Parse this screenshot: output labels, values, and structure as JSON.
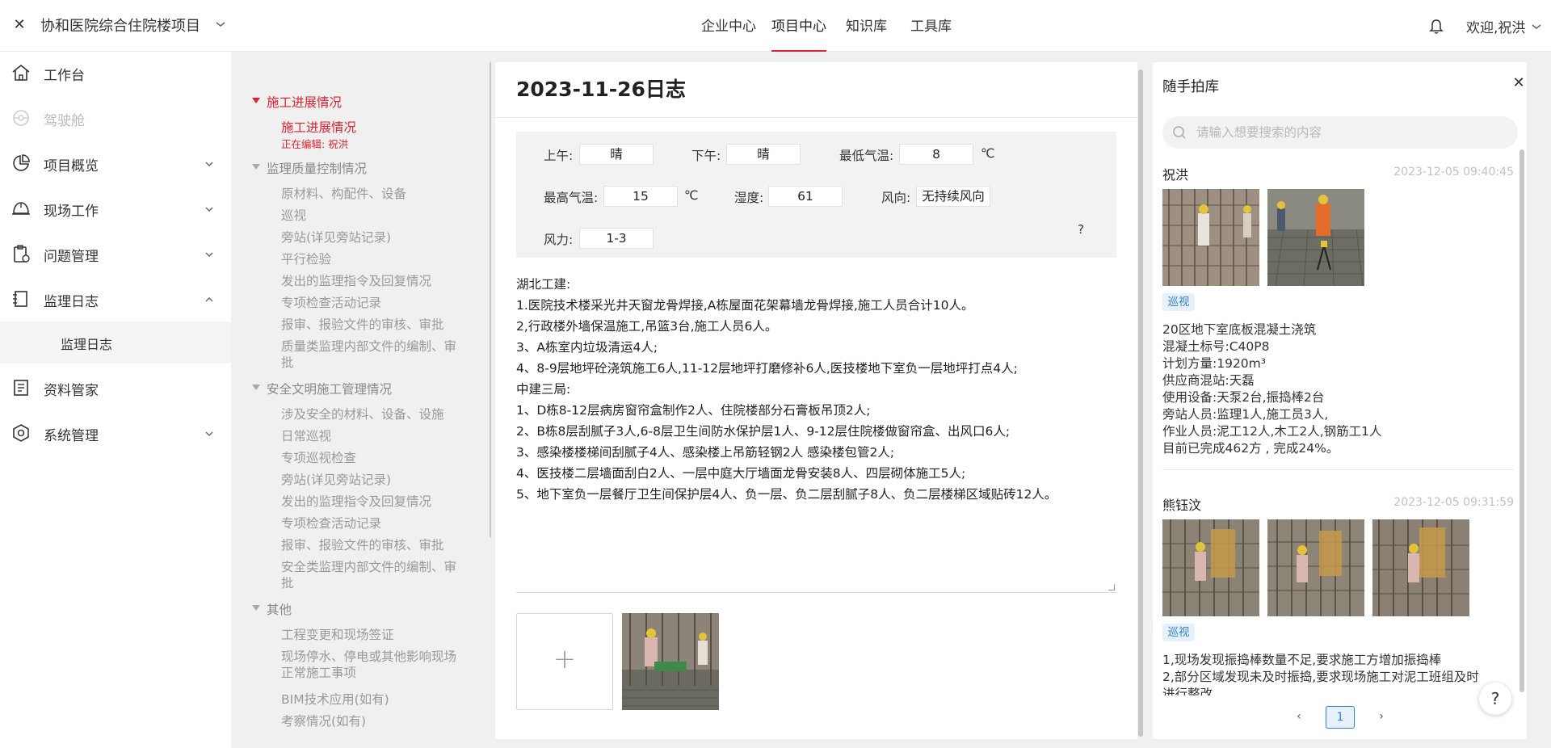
{
  "topbar": {
    "project_name": "协和医院综合住院楼项目",
    "nav": [
      "企业中心",
      "项目中心",
      "知识库",
      "工具库"
    ],
    "active_nav": "项目中心",
    "user_greeting": "欢迎,祝洪"
  },
  "sidebar": {
    "items": [
      {
        "label": "工作台",
        "icon": "home-icon"
      },
      {
        "label": "驾驶舱",
        "icon": "dashboard-icon"
      },
      {
        "label": "项目概览",
        "icon": "pie-chart-icon"
      },
      {
        "label": "现场工作",
        "icon": "helmet-icon"
      },
      {
        "label": "问题管理",
        "icon": "clipboard-icon"
      },
      {
        "label": "监理日志",
        "icon": "log-icon"
      },
      {
        "label": "资料管家",
        "icon": "document-icon"
      },
      {
        "label": "系统管理",
        "icon": "settings-icon"
      }
    ],
    "sub_item": "监理日志"
  },
  "tree": {
    "sec1": "施工进展情况",
    "sec1_item": "施工进展情况",
    "editing": "正在编辑: 祝洪",
    "sec2": "监理质量控制情况",
    "sec2_items": [
      "原材料、构配件、设备",
      "巡视",
      "旁站(详见旁站记录)",
      "平行检验",
      "发出的监理指令及回复情况",
      "专项检查活动记录",
      "报审、报验文件的审核、审批",
      "质量类监理内部文件的编制、审批"
    ],
    "sec3": "安全文明施工管理情况",
    "sec3_items": [
      "涉及安全的材料、设备、设施",
      "日常巡视",
      "专项巡视检查",
      "旁站(详见旁站记录)",
      "发出的监理指令及回复情况",
      "专项检查活动记录",
      "报审、报验文件的审核、审批",
      "安全类监理内部文件的编制、审批"
    ],
    "sec4": "其他",
    "sec4_items": [
      "工程变更和现场签证",
      "现场停水、停电或其他影响现场正常施工事项",
      "BIM技术应用(如有)",
      "考察情况(如有)"
    ]
  },
  "doc": {
    "title": "2023-11-26日志",
    "weather": {
      "am_label": "上午:",
      "am": "晴",
      "pm_label": "下午:",
      "pm": "晴",
      "tmin_label": "最低气温:",
      "tmin": "8",
      "tmax_label": "最高气温:",
      "tmax": "15",
      "unit": "℃",
      "humidity_label": "湿度:",
      "humidity": "61",
      "wind_dir_label": "风向:",
      "wind_dir": "无持续风向",
      "wind_label": "风力:",
      "wind": "1-3",
      "help": "?"
    },
    "lines": [
      "湖北工建:",
      "1.医院技术楼采光井天窗龙骨焊接,A栋屋面花架幕墙龙骨焊接,施工人员合计10人。",
      "2,行政楼外墙保温施工,吊篮3台,施工人员6人。",
      "3、A栋室内垃圾清运4人;",
      "4、8-9层地坪砼浇筑施工6人,11-12层地坪打磨修补6人,医技楼地下室负一层地坪打点4人;",
      "中建三局:",
      "1、D栋8-12层病房窗帘盒制作2人、住院楼部分石膏板吊顶2人;",
      "2、B栋8层刮腻子3人,6-8层卫生间防水保护层1人、9-12层住院楼做窗帘盒、出风口6人;",
      "3、感染楼楼梯间刮腻子4人、感染楼上吊筋轻钢2人 感染楼包管2人;",
      "4、医技楼二层墙面刮白2人、一层中庭大厅墙面龙骨安装8人、四层砌体施工5人;",
      "5、地下室负一层餐厅卫生间保护层4人、负一层、负二层刮腻子8人、负二层楼梯区域贴砖12人。"
    ],
    "upload_label": "+"
  },
  "photos": {
    "title": "随手拍库",
    "search_placeholder": "请输入想要搜索的内容",
    "cards": [
      {
        "author": "祝洪",
        "time": "2023-12-05 09:40:45",
        "tag": "巡视",
        "text": [
          " 20区地下室底板混凝土浇筑",
          "混凝土标号:C40P8",
          "计划方量:1920m³",
          "供应商混站:天磊",
          "使用设备:天泵2台,振捣棒2台",
          "旁站人员:监理1人,施工员3人,",
          "作业人员:泥工12人,木工2人,钢筋工1人",
          "目前已完成462方 , 完成24%。"
        ]
      },
      {
        "author": "熊钰汶",
        "time": "2023-12-05 09:31:59",
        "tag": "巡视",
        "text": [
          " 1,现场发现振捣棒数量不足,要求施工方增加振捣棒",
          "2,部分区域发现未及时振捣,要求现场施工对泥工班组及时",
          "进行整改"
        ]
      }
    ],
    "page": "1"
  },
  "colors": {
    "accent": "#e0212f",
    "tag_blue": "#2e7fd6"
  }
}
